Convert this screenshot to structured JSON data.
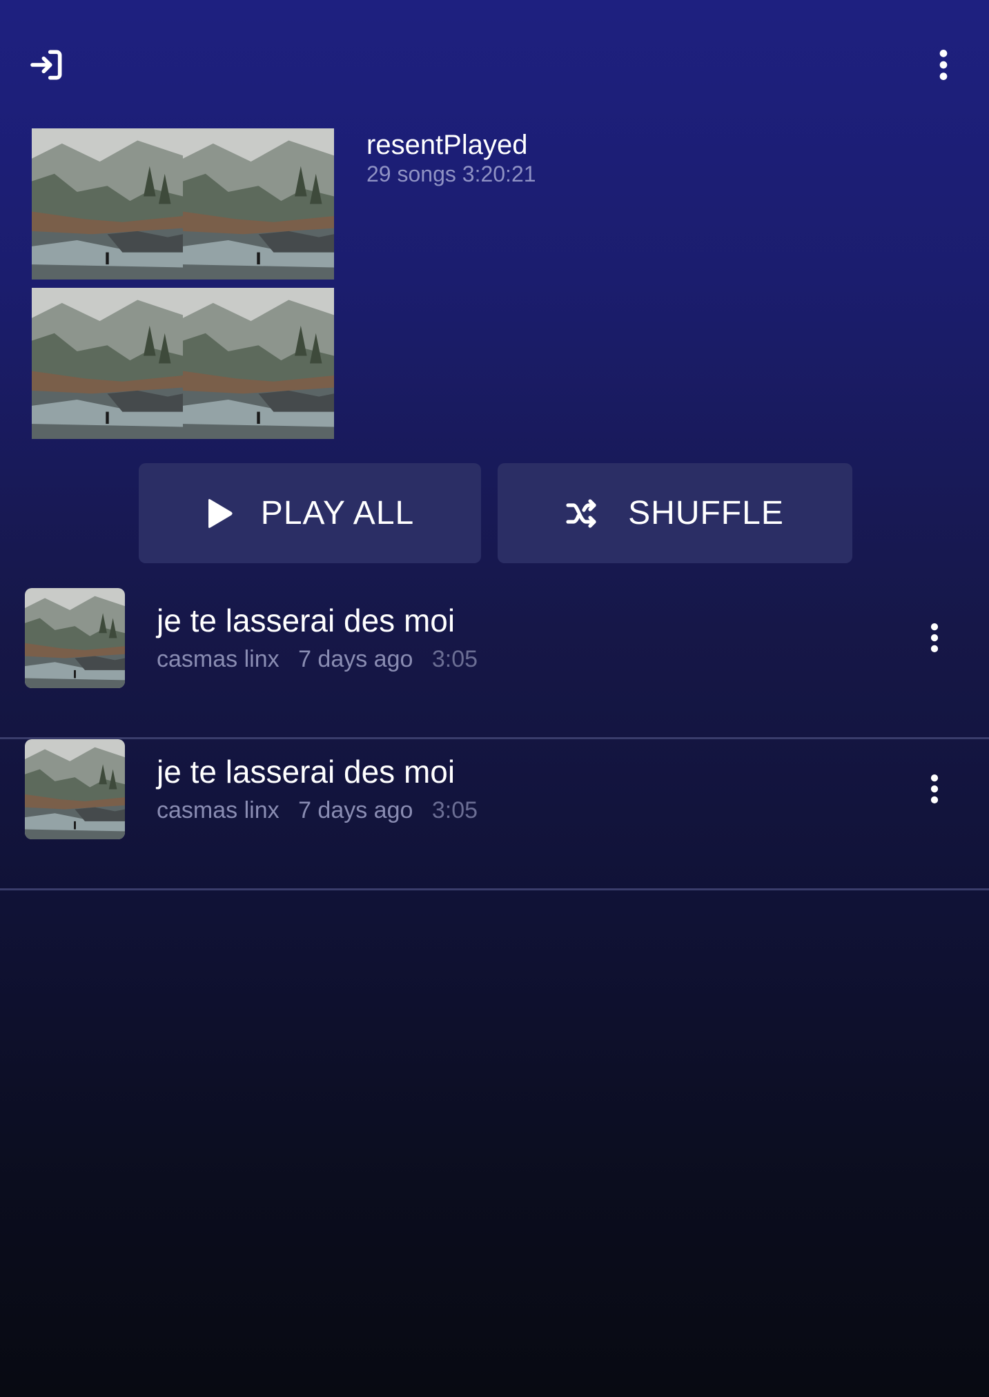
{
  "header": {
    "login_icon": "login-icon",
    "menu_icon": "more-vert-icon"
  },
  "playlist": {
    "title": "resentPlayed",
    "meta": "29 songs 3:20:21"
  },
  "actions": {
    "play_all_label": "PLAY ALL",
    "play_icon": "play-icon",
    "shuffle_label": "SHUFFLE",
    "shuffle_icon": "shuffle-icon"
  },
  "songs": [
    {
      "title": "je te lasserai des moi",
      "artist": "casmas linx",
      "added": "7 days ago",
      "duration": "3:05"
    },
    {
      "title": "je te lasserai des moi",
      "artist": "casmas linx",
      "added": "7 days ago",
      "duration": "3:05"
    }
  ],
  "colors": {
    "accent_button": "#2b2e65",
    "bg_top": "#1e2080",
    "bg_bottom": "#080a12"
  }
}
